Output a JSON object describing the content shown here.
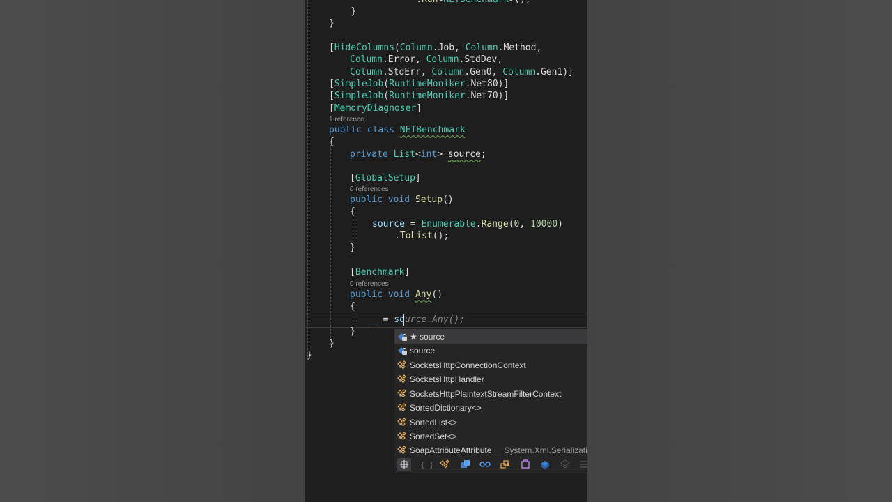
{
  "code": {
    "l0": "    .Run<NETBenchmark>();",
    "l1": "    }",
    "l2": "}",
    "hide_a": "HideColumns",
    "hide_b": "Column",
    "hide_c": "Job",
    "hide_d": "Method",
    "l4a": "Column",
    "l4b": "Error",
    "l4c": "StdDev",
    "l5a": "StdErr",
    "l5b": "Gen0",
    "l5c": "Gen1",
    "simplejob": "SimpleJob",
    "moniker": "RuntimeMoniker",
    "net80": "Net80",
    "net70": "Net70",
    "memdiag": "MemoryDiagnoser",
    "lens_class": "1 reference",
    "kw_public": "public",
    "kw_class": "class",
    "class_name": "NETBenchmark",
    "brace_open": "{",
    "brace_close": "}",
    "kw_private": "private",
    "list_type": "List",
    "kw_int": "int",
    "field_name": "source",
    "globalsetup": "GlobalSetup",
    "lens_setup": "0 references",
    "kw_void": "void",
    "setup_name": "Setup",
    "assign_target": "source",
    "enumerable": "Enumerable",
    "range": "Range",
    "n0": "0",
    "n10000": "10000",
    "tolist": "ToList",
    "benchmark": "Benchmark",
    "lens_any": "0 references",
    "any_name": "Any",
    "discard": "_",
    "typed": "so",
    "ghost": "urce.Any();"
  },
  "completion": {
    "items": [
      {
        "label": "★ source",
        "icon": "field-lock-icon",
        "selected": true
      },
      {
        "label": "source",
        "icon": "field-lock-icon",
        "selected": false
      },
      {
        "label": "SocketsHttpConnectionContext",
        "icon": "class-icon",
        "selected": false
      },
      {
        "label": "SocketsHttpHandler",
        "icon": "class-icon",
        "selected": false
      },
      {
        "label": "SocketsHttpPlaintextStreamFilterContext",
        "icon": "class-icon",
        "selected": false
      },
      {
        "label": "SortedDictionary<>",
        "icon": "class-icon",
        "selected": false
      },
      {
        "label": "SortedList<>",
        "icon": "class-icon",
        "selected": false
      },
      {
        "label": "SortedSet<>",
        "icon": "class-icon",
        "selected": false
      },
      {
        "label": "SoapAttributeAttribute",
        "detail": "System.Xml.Serializati",
        "icon": "class-icon",
        "selected": false
      }
    ],
    "filters": [
      "expand-icon",
      "namespace-icon",
      "class-filter-icon",
      "struct-filter-icon",
      "interface-filter-icon",
      "delegate-filter-icon",
      "method-filter-icon",
      "field-filter-icon",
      "enum-filter-icon",
      "more-icon"
    ]
  }
}
